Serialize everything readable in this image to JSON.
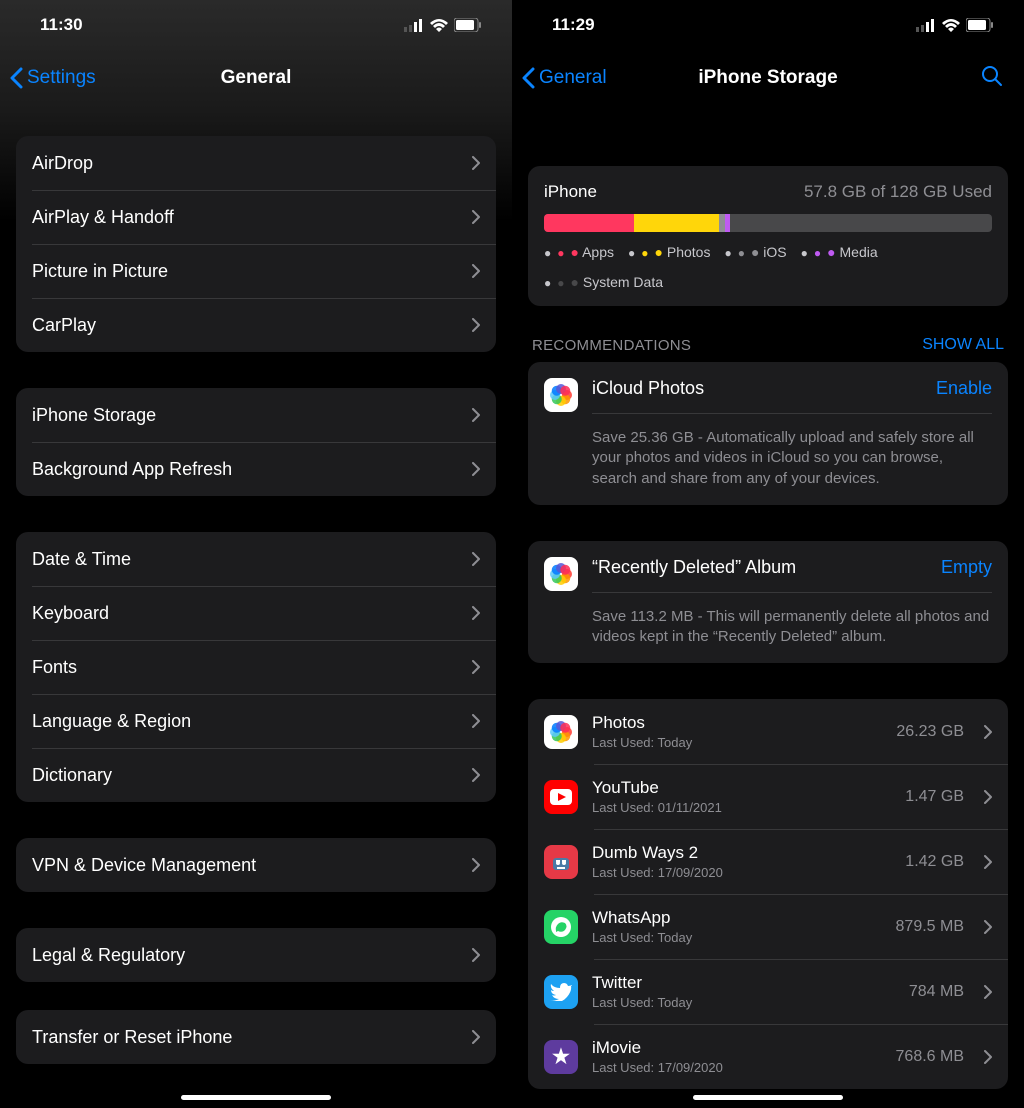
{
  "left": {
    "time": "11:30",
    "back": "Settings",
    "title": "General",
    "groups": [
      [
        "AirDrop",
        "AirPlay & Handoff",
        "Picture in Picture",
        "CarPlay"
      ],
      [
        "iPhone Storage",
        "Background App Refresh"
      ],
      [
        "Date & Time",
        "Keyboard",
        "Fonts",
        "Language & Region",
        "Dictionary"
      ],
      [
        "VPN & Device Management"
      ],
      [
        "Legal & Regulatory"
      ],
      [
        "Transfer or Reset iPhone"
      ]
    ]
  },
  "right": {
    "time": "11:29",
    "back": "General",
    "title": "iPhone Storage",
    "storage": {
      "device": "iPhone",
      "used_text": "57.8 GB of 128 GB Used",
      "segments": [
        {
          "label": "Apps",
          "color": "#ff375f",
          "pct": 20
        },
        {
          "label": "Photos",
          "color": "#ffd60a",
          "pct": 19
        },
        {
          "label": "iOS",
          "color": "#8e8e93",
          "pct": 1.5
        },
        {
          "label": "Media",
          "color": "#bf5af2",
          "pct": 1
        },
        {
          "label": "System Data",
          "color": "#48484a",
          "pct": 3.5
        }
      ]
    },
    "recommendations_header": "RECOMMENDATIONS",
    "show_all": "SHOW ALL",
    "recs": [
      {
        "title": "iCloud Photos",
        "action": "Enable",
        "desc": "Save 25.36 GB - Automatically upload and safely store all your photos and videos in iCloud so you can browse, search and share from any of your devices."
      },
      {
        "title": "“Recently Deleted” Album",
        "action": "Empty",
        "desc": "Save 113.2 MB - This will permanently delete all photos and videos kept in the “Recently Deleted” album."
      }
    ],
    "apps": [
      {
        "name": "Photos",
        "sub": "Last Used: Today",
        "size": "26.23 GB",
        "bg": "#fff",
        "icon": "photos"
      },
      {
        "name": "YouTube",
        "sub": "Last Used: 01/11/2021",
        "size": "1.47 GB",
        "bg": "#ff0000",
        "icon": "yt"
      },
      {
        "name": "Dumb Ways 2",
        "sub": "Last Used: 17/09/2020",
        "size": "1.42 GB",
        "bg": "#e63946",
        "icon": "dw"
      },
      {
        "name": "WhatsApp",
        "sub": "Last Used: Today",
        "size": "879.5 MB",
        "bg": "#25d366",
        "icon": "wa"
      },
      {
        "name": "Twitter",
        "sub": "Last Used: Today",
        "size": "784 MB",
        "bg": "#1da1f2",
        "icon": "tw"
      },
      {
        "name": "iMovie",
        "sub": "Last Used: 17/09/2020",
        "size": "768.6 MB",
        "bg": "#5e3b9e",
        "icon": "im"
      }
    ]
  }
}
